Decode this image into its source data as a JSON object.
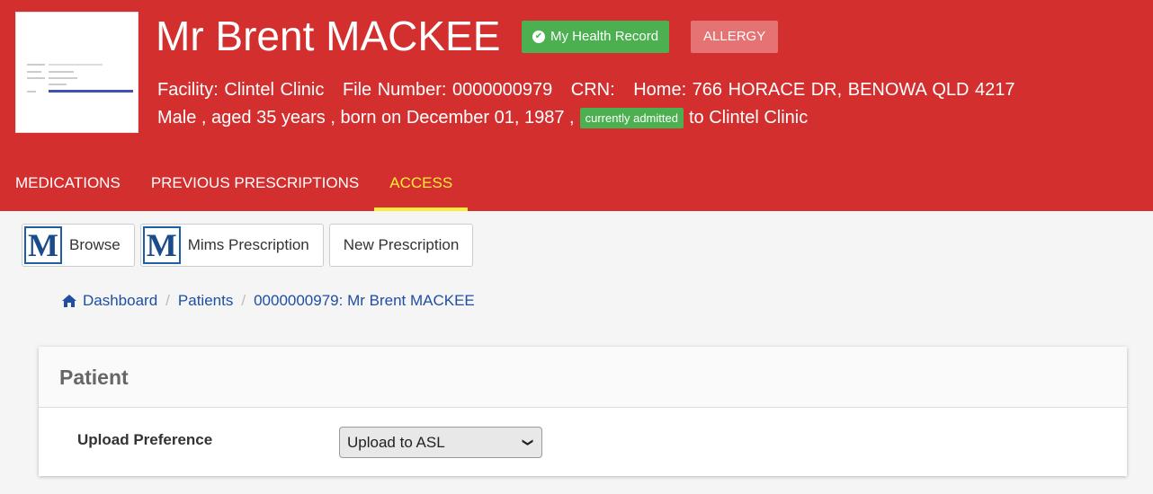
{
  "patient": {
    "name": "Mr Brent MACKEE",
    "mhr_badge": "My Health Record",
    "allergy_badge": "ALLERGY",
    "facility": "Facility: Clintel Clinic",
    "file_number": "File Number: 0000000979",
    "crn": "CRN:",
    "home": "Home: 766 HORACE DR, BENOWA QLD 4217",
    "demographics": "Male , aged 35 years , born on December 01, 1987 ,",
    "admitted_badge": "currently admitted",
    "admitted_to": "to Clintel Clinic"
  },
  "tabs": [
    {
      "label": "MEDICATIONS"
    },
    {
      "label": "PREVIOUS PRESCRIPTIONS"
    },
    {
      "label": "ACCESS"
    }
  ],
  "toolbar": {
    "browse_label": "Browse",
    "mims_label": "Mims Prescription",
    "new_label": "New Prescription",
    "logo_letter": "M"
  },
  "breadcrumb": {
    "dashboard": "Dashboard",
    "patients": "Patients",
    "current": "0000000979: Mr Brent MACKEE",
    "separator": "/"
  },
  "card": {
    "title": "Patient",
    "upload_label": "Upload Preference",
    "upload_value": "Upload to ASL"
  },
  "colors": {
    "header_bg": "#d32f2f",
    "active_tab": "#ffeb3b",
    "success": "#4caf50",
    "link": "#1f4ea3"
  },
  "icons": {
    "home": "home-icon",
    "check": "check-circle-icon",
    "dropdown": "chevron-down-icon"
  }
}
